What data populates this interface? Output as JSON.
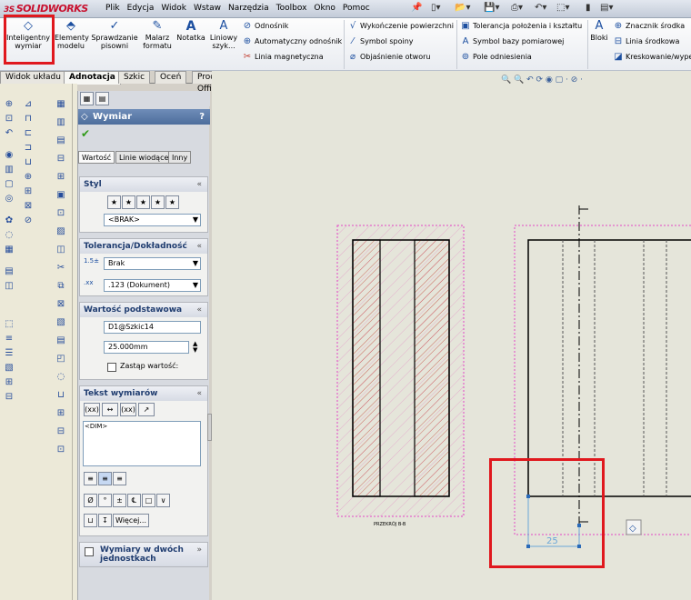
{
  "app": {
    "logo": "SOLIDWORKS"
  },
  "menu": [
    "Plik",
    "Edycja",
    "Widok",
    "Wstaw",
    "Narzędzia",
    "Toolbox",
    "Okno",
    "Pomoc"
  ],
  "ribbon": {
    "smart_dim": {
      "l1": "Inteligentny",
      "l2": "wymiar"
    },
    "model_items": {
      "l1": "Elementy",
      "l2": "modelu"
    },
    "spell": {
      "l1": "Sprawdzanie",
      "l2": "pisowni"
    },
    "painter": {
      "l1": "Malarz",
      "l2": "formatu"
    },
    "note": "Notatka",
    "linear": {
      "l1": "Liniowy",
      "l2": "szyk..."
    },
    "balloon": "Odnośnik",
    "auto_balloon": "Automatyczny odnośnik",
    "magnetic": "Linia magnetyczna",
    "surface": "Wykończenie powierzchni",
    "weld": "Symbol spoiny",
    "hole": "Objaśnienie otworu",
    "gtol": "Tolerancja położenia i kształtu",
    "datum": "Symbol bazy pomiarowej",
    "datum_target": "Pole odniesienia",
    "blocks": "Bloki",
    "center_mark": "Znacznik środka",
    "centerline": "Linia środkowa",
    "hatch": "Kreskowanie/wype"
  },
  "tabs": [
    "Widok układu",
    "Adnotacja",
    "Szkic",
    "Oceń",
    "Produkty Office"
  ],
  "active_tab": "Adnotacja",
  "pm": {
    "title": "Wymiar",
    "help": "?",
    "subtabs": [
      "Wartość",
      "Linie wiodące",
      "Inny"
    ],
    "style_header": "Styl",
    "style_value": "<BRAK>",
    "tol_header": "Tolerancja/Dokładność",
    "tol_type": "Brak",
    "precision": ".123 (Dokument)",
    "primary_header": "Wartość podstawowa",
    "dim_name": "D1@Szkic14",
    "dim_value": "25.000mm",
    "override_label": "Zastąp wartość:",
    "text_header": "Tekst wymiarów",
    "dim_text": "<DIM>",
    "more_btn": "Więcej...",
    "dual_header": "Wymiary w dwóch jednostkach"
  },
  "drawing": {
    "dim_value": "25",
    "view_label": "PRZEKRÓJ B-B"
  }
}
